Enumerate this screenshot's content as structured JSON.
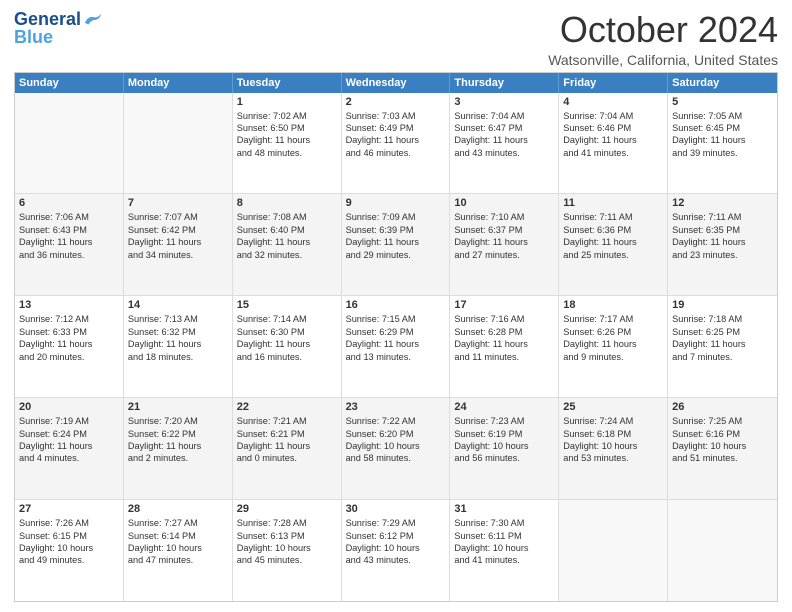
{
  "logo": {
    "general": "General",
    "blue": "Blue"
  },
  "title": "October 2024",
  "location": "Watsonville, California, United States",
  "days_of_week": [
    "Sunday",
    "Monday",
    "Tuesday",
    "Wednesday",
    "Thursday",
    "Friday",
    "Saturday"
  ],
  "rows": [
    [
      {
        "day": "",
        "lines": [],
        "empty": true
      },
      {
        "day": "",
        "lines": [],
        "empty": true
      },
      {
        "day": "1",
        "lines": [
          "Sunrise: 7:02 AM",
          "Sunset: 6:50 PM",
          "Daylight: 11 hours",
          "and 48 minutes."
        ],
        "empty": false
      },
      {
        "day": "2",
        "lines": [
          "Sunrise: 7:03 AM",
          "Sunset: 6:49 PM",
          "Daylight: 11 hours",
          "and 46 minutes."
        ],
        "empty": false
      },
      {
        "day": "3",
        "lines": [
          "Sunrise: 7:04 AM",
          "Sunset: 6:47 PM",
          "Daylight: 11 hours",
          "and 43 minutes."
        ],
        "empty": false
      },
      {
        "day": "4",
        "lines": [
          "Sunrise: 7:04 AM",
          "Sunset: 6:46 PM",
          "Daylight: 11 hours",
          "and 41 minutes."
        ],
        "empty": false
      },
      {
        "day": "5",
        "lines": [
          "Sunrise: 7:05 AM",
          "Sunset: 6:45 PM",
          "Daylight: 11 hours",
          "and 39 minutes."
        ],
        "empty": false
      }
    ],
    [
      {
        "day": "6",
        "lines": [
          "Sunrise: 7:06 AM",
          "Sunset: 6:43 PM",
          "Daylight: 11 hours",
          "and 36 minutes."
        ],
        "empty": false
      },
      {
        "day": "7",
        "lines": [
          "Sunrise: 7:07 AM",
          "Sunset: 6:42 PM",
          "Daylight: 11 hours",
          "and 34 minutes."
        ],
        "empty": false
      },
      {
        "day": "8",
        "lines": [
          "Sunrise: 7:08 AM",
          "Sunset: 6:40 PM",
          "Daylight: 11 hours",
          "and 32 minutes."
        ],
        "empty": false
      },
      {
        "day": "9",
        "lines": [
          "Sunrise: 7:09 AM",
          "Sunset: 6:39 PM",
          "Daylight: 11 hours",
          "and 29 minutes."
        ],
        "empty": false
      },
      {
        "day": "10",
        "lines": [
          "Sunrise: 7:10 AM",
          "Sunset: 6:37 PM",
          "Daylight: 11 hours",
          "and 27 minutes."
        ],
        "empty": false
      },
      {
        "day": "11",
        "lines": [
          "Sunrise: 7:11 AM",
          "Sunset: 6:36 PM",
          "Daylight: 11 hours",
          "and 25 minutes."
        ],
        "empty": false
      },
      {
        "day": "12",
        "lines": [
          "Sunrise: 7:11 AM",
          "Sunset: 6:35 PM",
          "Daylight: 11 hours",
          "and 23 minutes."
        ],
        "empty": false
      }
    ],
    [
      {
        "day": "13",
        "lines": [
          "Sunrise: 7:12 AM",
          "Sunset: 6:33 PM",
          "Daylight: 11 hours",
          "and 20 minutes."
        ],
        "empty": false
      },
      {
        "day": "14",
        "lines": [
          "Sunrise: 7:13 AM",
          "Sunset: 6:32 PM",
          "Daylight: 11 hours",
          "and 18 minutes."
        ],
        "empty": false
      },
      {
        "day": "15",
        "lines": [
          "Sunrise: 7:14 AM",
          "Sunset: 6:30 PM",
          "Daylight: 11 hours",
          "and 16 minutes."
        ],
        "empty": false
      },
      {
        "day": "16",
        "lines": [
          "Sunrise: 7:15 AM",
          "Sunset: 6:29 PM",
          "Daylight: 11 hours",
          "and 13 minutes."
        ],
        "empty": false
      },
      {
        "day": "17",
        "lines": [
          "Sunrise: 7:16 AM",
          "Sunset: 6:28 PM",
          "Daylight: 11 hours",
          "and 11 minutes."
        ],
        "empty": false
      },
      {
        "day": "18",
        "lines": [
          "Sunrise: 7:17 AM",
          "Sunset: 6:26 PM",
          "Daylight: 11 hours",
          "and 9 minutes."
        ],
        "empty": false
      },
      {
        "day": "19",
        "lines": [
          "Sunrise: 7:18 AM",
          "Sunset: 6:25 PM",
          "Daylight: 11 hours",
          "and 7 minutes."
        ],
        "empty": false
      }
    ],
    [
      {
        "day": "20",
        "lines": [
          "Sunrise: 7:19 AM",
          "Sunset: 6:24 PM",
          "Daylight: 11 hours",
          "and 4 minutes."
        ],
        "empty": false
      },
      {
        "day": "21",
        "lines": [
          "Sunrise: 7:20 AM",
          "Sunset: 6:22 PM",
          "Daylight: 11 hours",
          "and 2 minutes."
        ],
        "empty": false
      },
      {
        "day": "22",
        "lines": [
          "Sunrise: 7:21 AM",
          "Sunset: 6:21 PM",
          "Daylight: 11 hours",
          "and 0 minutes."
        ],
        "empty": false
      },
      {
        "day": "23",
        "lines": [
          "Sunrise: 7:22 AM",
          "Sunset: 6:20 PM",
          "Daylight: 10 hours",
          "and 58 minutes."
        ],
        "empty": false
      },
      {
        "day": "24",
        "lines": [
          "Sunrise: 7:23 AM",
          "Sunset: 6:19 PM",
          "Daylight: 10 hours",
          "and 56 minutes."
        ],
        "empty": false
      },
      {
        "day": "25",
        "lines": [
          "Sunrise: 7:24 AM",
          "Sunset: 6:18 PM",
          "Daylight: 10 hours",
          "and 53 minutes."
        ],
        "empty": false
      },
      {
        "day": "26",
        "lines": [
          "Sunrise: 7:25 AM",
          "Sunset: 6:16 PM",
          "Daylight: 10 hours",
          "and 51 minutes."
        ],
        "empty": false
      }
    ],
    [
      {
        "day": "27",
        "lines": [
          "Sunrise: 7:26 AM",
          "Sunset: 6:15 PM",
          "Daylight: 10 hours",
          "and 49 minutes."
        ],
        "empty": false
      },
      {
        "day": "28",
        "lines": [
          "Sunrise: 7:27 AM",
          "Sunset: 6:14 PM",
          "Daylight: 10 hours",
          "and 47 minutes."
        ],
        "empty": false
      },
      {
        "day": "29",
        "lines": [
          "Sunrise: 7:28 AM",
          "Sunset: 6:13 PM",
          "Daylight: 10 hours",
          "and 45 minutes."
        ],
        "empty": false
      },
      {
        "day": "30",
        "lines": [
          "Sunrise: 7:29 AM",
          "Sunset: 6:12 PM",
          "Daylight: 10 hours",
          "and 43 minutes."
        ],
        "empty": false
      },
      {
        "day": "31",
        "lines": [
          "Sunrise: 7:30 AM",
          "Sunset: 6:11 PM",
          "Daylight: 10 hours",
          "and 41 minutes."
        ],
        "empty": false
      },
      {
        "day": "",
        "lines": [],
        "empty": true
      },
      {
        "day": "",
        "lines": [],
        "empty": true
      }
    ]
  ]
}
